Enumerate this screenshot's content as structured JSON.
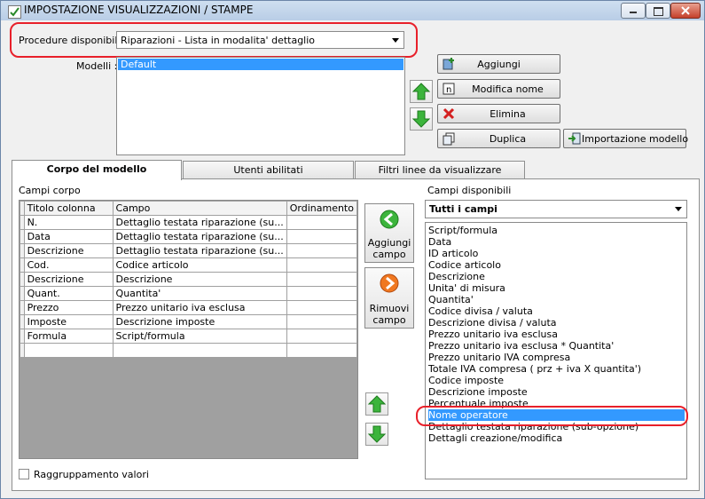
{
  "window": {
    "title": "IMPOSTAZIONE VISUALIZZAZIONI / STAMPE"
  },
  "procedure": {
    "label": "Procedure disponibili :",
    "value": "Riparazioni - Lista in modalita' dettaglio"
  },
  "modelli": {
    "label": "Modelli :",
    "items": [
      "Default"
    ]
  },
  "buttons": {
    "aggiungi": "Aggiungi",
    "modifica_nome": "Modifica nome",
    "elimina": "Elimina",
    "duplica": "Duplica",
    "importazione": "Importazione modello"
  },
  "tabs": [
    "Corpo del modello",
    "Utenti abilitati",
    "Filtri linee da visualizzare"
  ],
  "campi_corpo": {
    "label": "Campi corpo",
    "headers": [
      "Titolo colonna",
      "Campo",
      "Ordinamento"
    ],
    "rows": [
      [
        "N.",
        "Dettaglio testata riparazione (su...",
        ""
      ],
      [
        "Data",
        "Dettaglio testata riparazione (su...",
        ""
      ],
      [
        "Descrizione",
        "Dettaglio testata riparazione (su...",
        ""
      ],
      [
        "Cod.",
        "Codice articolo",
        ""
      ],
      [
        "Descrizione",
        "Descrizione",
        ""
      ],
      [
        "Quant.",
        "Quantita'",
        ""
      ],
      [
        "Prezzo",
        "Prezzo unitario iva esclusa",
        ""
      ],
      [
        "Imposte",
        "Descrizione imposte",
        ""
      ],
      [
        "Formula",
        "Script/formula",
        ""
      ],
      [
        "",
        "",
        ""
      ]
    ]
  },
  "side": {
    "aggiungi_campo": [
      "Aggiungi",
      "campo"
    ],
    "rimuovi_campo": [
      "Rimuovi",
      "campo"
    ]
  },
  "campi_disponibili": {
    "label": "Campi disponibili",
    "filter": "Tutti i campi",
    "items": [
      "Script/formula",
      "Data",
      "ID articolo",
      "Codice articolo",
      "Descrizione",
      "Unita' di misura",
      "Quantita'",
      "Codice divisa / valuta",
      "Descrizione divisa / valuta",
      "Prezzo unitario iva esclusa",
      "Prezzo unitario iva esclusa * Quantita'",
      "Prezzo unitario IVA compresa",
      "Totale IVA compresa ( prz + iva X quantita')",
      "Codice imposte",
      "Descrizione imposte",
      "Percentuale imposte",
      "Nome operatore",
      "Dettaglio testata riparazione (sub-opzione)",
      "Dettagli creazione/modifica"
    ],
    "selected_index": 16
  },
  "raggruppamento": {
    "label": "Raggruppamento valori",
    "checked": false
  },
  "colors": {
    "selection": "#3399ff",
    "highlight_outline": "#e8202a",
    "arrow_green": "#3cb43c",
    "arrow_orange": "#f07820"
  }
}
